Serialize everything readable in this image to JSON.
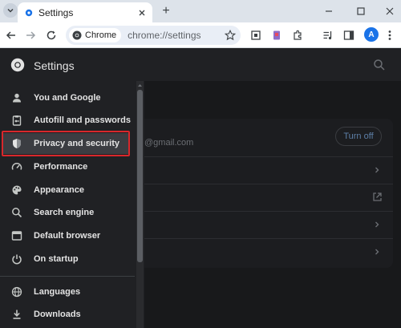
{
  "browser": {
    "tab_title": "Settings",
    "new_tab_symbol": "+",
    "omnibox_chip": "Chrome",
    "url": "chrome://settings",
    "profile_initial": "A"
  },
  "settings": {
    "title": "Settings"
  },
  "sidebar": {
    "items": [
      {
        "label": "You and Google",
        "icon": "person-icon"
      },
      {
        "label": "Autofill and passwords",
        "icon": "clipboard-key-icon"
      },
      {
        "label": "Privacy and security",
        "icon": "shield-icon",
        "active": true
      },
      {
        "label": "Performance",
        "icon": "speedometer-icon"
      },
      {
        "label": "Appearance",
        "icon": "palette-icon"
      },
      {
        "label": "Search engine",
        "icon": "search-icon"
      },
      {
        "label": "Default browser",
        "icon": "browser-window-icon"
      },
      {
        "label": "On startup",
        "icon": "power-icon"
      },
      {
        "label": "Languages",
        "icon": "globe-icon"
      },
      {
        "label": "Downloads",
        "icon": "download-icon"
      }
    ]
  },
  "main": {
    "email_suffix": "@gmail.com",
    "turn_off_label": "Turn off"
  },
  "colors": {
    "highlight": "#d8272b",
    "accent": "#1a73e8"
  }
}
